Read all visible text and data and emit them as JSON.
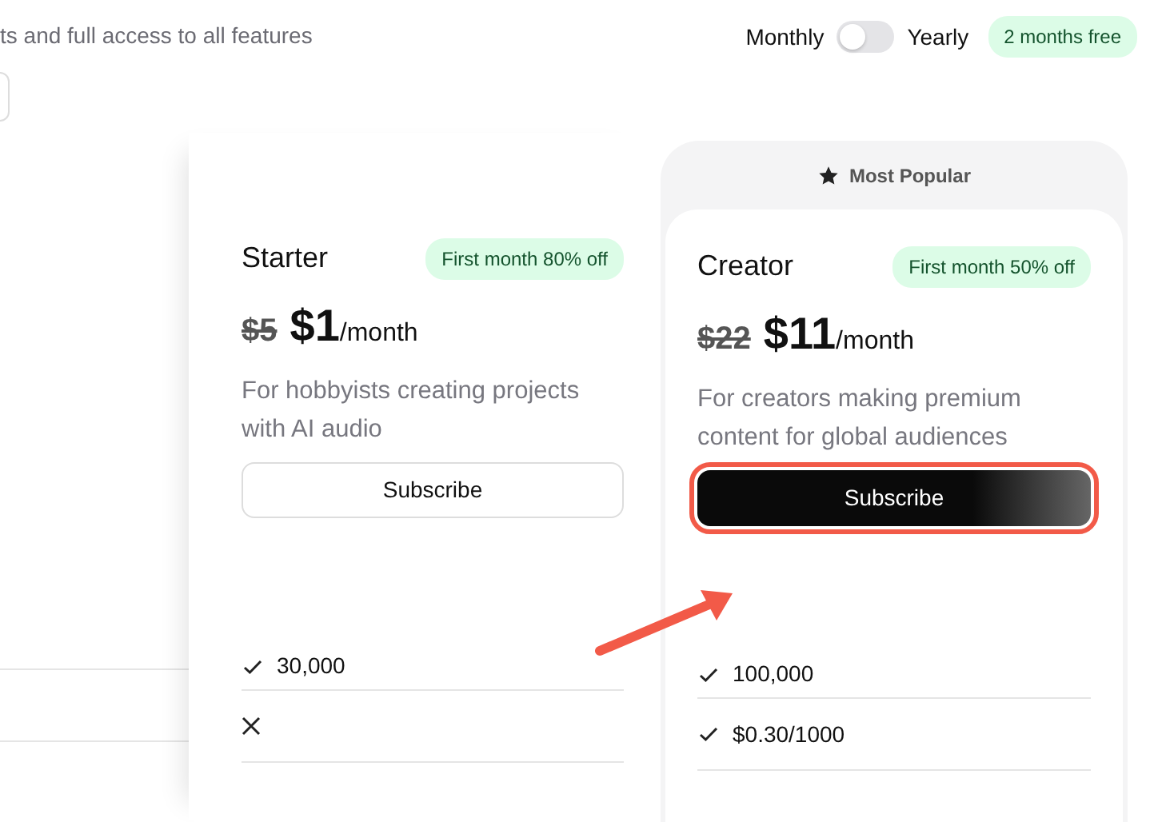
{
  "subtitle": "ts and full access to all features",
  "billing": {
    "monthly_label": "Monthly",
    "yearly_label": "Yearly",
    "yearly": false,
    "badge": "2 months free"
  },
  "plans": [
    {
      "name": "Starter",
      "badge": "First month 80% off",
      "old_price": "$5",
      "price": "$1",
      "period": "/month",
      "description": "For hobbyists creating projects with AI audio",
      "button": "Subscribe",
      "popular": false,
      "highlighted": false,
      "features": [
        {
          "kind": "check",
          "text": "30,000"
        },
        {
          "kind": "cross"
        }
      ]
    },
    {
      "name": "Creator",
      "popular_label": "Most Popular",
      "badge": "First month 50% off",
      "old_price": "$22",
      "price": "$11",
      "period": "/month",
      "description": "For creators making premium content for global audiences",
      "button": "Subscribe",
      "popular": true,
      "highlighted": true,
      "features": [
        {
          "kind": "check",
          "text": "100,000"
        },
        {
          "kind": "check",
          "text": "$0.30/1000"
        }
      ]
    }
  ]
}
